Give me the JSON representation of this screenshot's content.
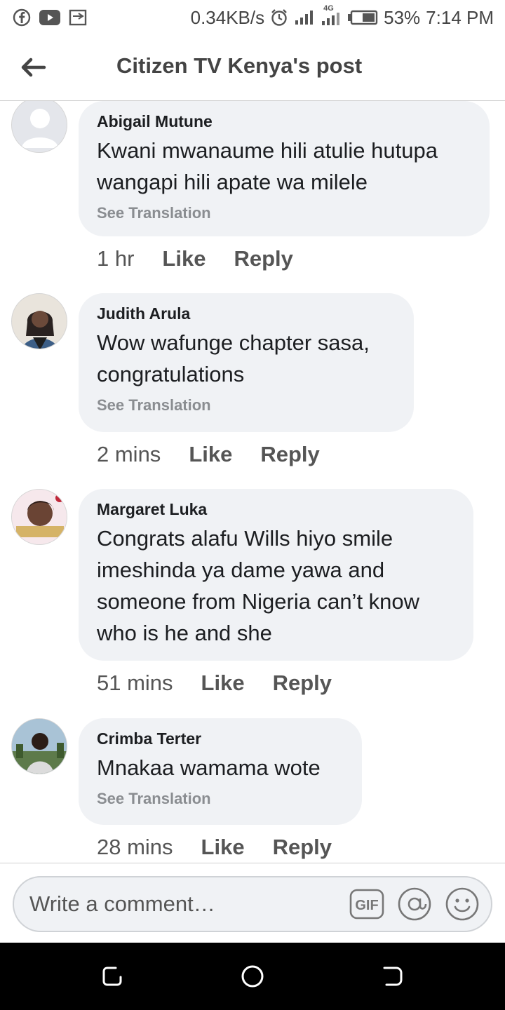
{
  "status_bar": {
    "network_speed": "0.34KB/s",
    "network_type": "4G",
    "battery": "53%",
    "time": "7:14 PM",
    "icons": [
      "facebook-icon",
      "youtube-icon",
      "cast-icon",
      "alarm-icon",
      "signal-icon",
      "battery-icon"
    ]
  },
  "header": {
    "title": "Citizen TV Kenya's post"
  },
  "comments": [
    {
      "author": "Abigail Mutune",
      "text": "Kwani mwanaume hili atulie hutupa wangapi  hili apate wa milele",
      "see_translation": "See Translation",
      "time": "1 hr",
      "like": "Like",
      "reply": "Reply"
    },
    {
      "author": "Judith Arula",
      "text": "Wow wafunge chapter sasa, congratulations",
      "see_translation": "See Translation",
      "time": "2 mins",
      "like": "Like",
      "reply": "Reply"
    },
    {
      "author": "Margaret Luka",
      "text": "Congrats alafu Wills hiyo smile imeshinda ya dame yawa and someone from Nigeria can’t know who is he and she",
      "time": "51 mins",
      "like": "Like",
      "reply": "Reply"
    },
    {
      "author": "Crimba Terter",
      "text": "Mnakaa wamama wote",
      "see_translation": "See Translation",
      "time": "28 mins",
      "like": "Like",
      "reply": "Reply"
    }
  ],
  "composer": {
    "placeholder": "Write a comment…",
    "gif_label": "GIF"
  },
  "colors": {
    "bubble": "#f0f2f5",
    "secondary_text": "#8a8d91",
    "nav_bar": "#000000"
  }
}
